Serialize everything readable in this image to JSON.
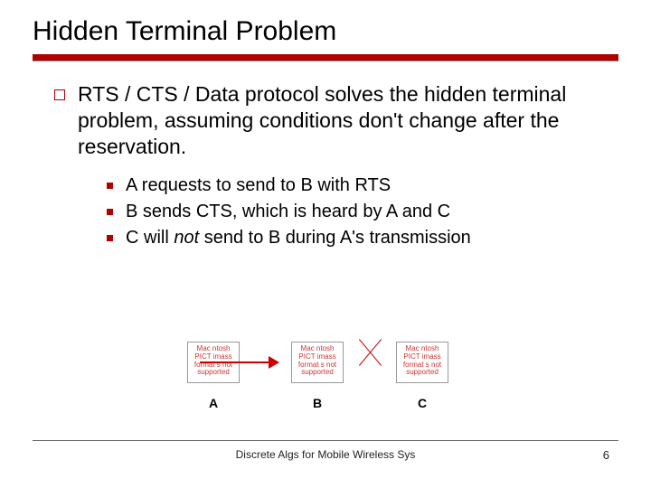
{
  "title": "Hidden Terminal Problem",
  "outer_text": "RTS / CTS / Data protocol solves the hidden terminal problem, assuming conditions don't change after the reservation.",
  "inner": [
    "A requests to send to B with RTS",
    "B sends CTS, which is heard by A and C",
    "C will not send to B during A's transmission"
  ],
  "placeholder": "Mac ntosh PICT imass format s not supported",
  "labels": {
    "a": "A",
    "b": "B",
    "c": "C"
  },
  "footer": "Discrete Algs for Mobile Wireless Sys",
  "page": "6"
}
